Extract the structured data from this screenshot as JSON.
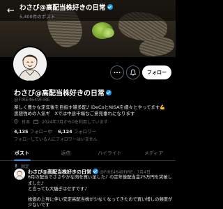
{
  "topbar": {
    "back_glyph": "←",
    "title": "わさび@高配当株好きの日常",
    "subtitle": "5,400件のポスト"
  },
  "profile": {
    "name": "わさび@高配当株好きの日常",
    "handle": "@FIRE4649FIRE",
    "bio": "楽しく豊かな定年後を目指す雑多配♪ iDeCoとNISAを細々とやってます💪 思想強めの人気ギ　Xでは中途半端なご意見垂れになります",
    "location": "日本",
    "joined": "2024年7月から0を利用しています",
    "following_count": "4,135",
    "following_label": "フォロー中",
    "followers_count": "6,124",
    "followers_label": "フォロワー",
    "followed_by": "フォローしている人にフォロワーはいません"
  },
  "actions": {
    "more_icon": "more-icon",
    "bell_icon": "bell-icon",
    "follow_label": "フォロー"
  },
  "tabs": [
    {
      "label": "ポスト"
    },
    {
      "label": "返信"
    },
    {
      "label": "ハイライト"
    },
    {
      "label": "メディア"
    }
  ],
  "pinned": {
    "label": "固定"
  },
  "post": {
    "author": "わさび@高配当株好きの日常",
    "handle": "@FIRE4649FIRE · 7月4日",
    "lines": [
      "6月の配当でささやかな肉を買い足した♪ の定年後配当金25万円を突破しました♪",
      "と言っても大騒ぎはせずです♪",
      "",
      "株価の上昇に伴い安定高配当株が少なくなってきたので買い増しの頻度が少ないです"
    ]
  },
  "colors": {
    "background": "#000000",
    "accent": "#1d9bf0",
    "text_secondary": "#71767b"
  }
}
